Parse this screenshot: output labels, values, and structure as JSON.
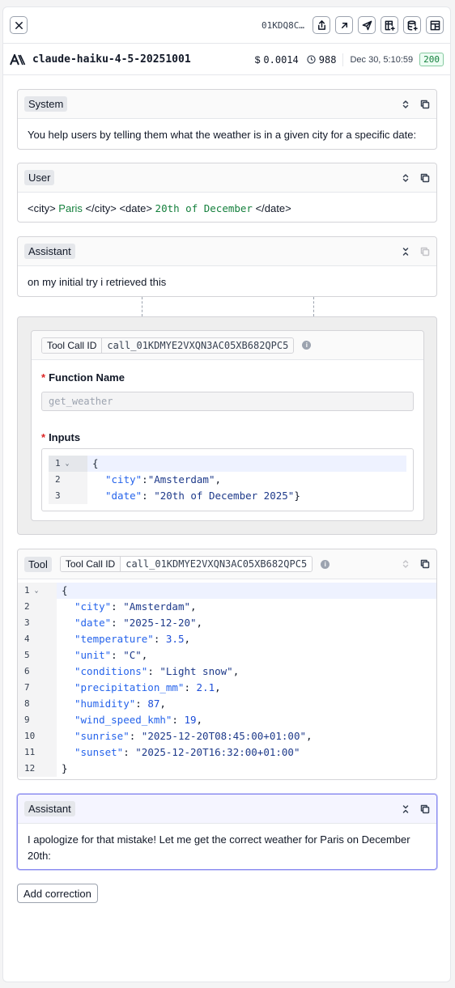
{
  "topbar": {
    "trace_id": "01KDQ8C…"
  },
  "model": {
    "name": "claude-haiku-4-5-20251001",
    "cost": "0.0014",
    "tokens": "988",
    "date": "Dec 30, 5:10:59",
    "status": "200"
  },
  "messages": {
    "system": {
      "role": "System",
      "text": "You help users by telling them what the weather is in a given city for a specific date:"
    },
    "user": {
      "role": "User",
      "parts": [
        "<city> ",
        "Paris",
        " </city> <date> ",
        "20th of December",
        " </date>"
      ]
    },
    "assistant1": {
      "role": "Assistant",
      "text": "on my initial try i retrieved this"
    },
    "tool_call": {
      "id_label": "Tool Call ID",
      "id_value": "call_01KDMYE2VXQN3AC05XB682QPC5",
      "function_label": "Function Name",
      "function_name": "get_weather",
      "inputs_label": "Inputs",
      "inputs_lines": [
        {
          "ln": "1",
          "text": "{"
        },
        {
          "ln": "2",
          "key": "\"city\"",
          "sep": ":",
          "val": "\"Amsterdam\"",
          "end": ","
        },
        {
          "ln": "3",
          "key": "\"date\"",
          "sep": ": ",
          "val": "\"20th of December 2025\"",
          "end": "}"
        }
      ]
    },
    "tool": {
      "role": "Tool",
      "id_label": "Tool Call ID",
      "id_value": "call_01KDMYE2VXQN3AC05XB682QPC5",
      "lines": [
        {
          "ln": "1",
          "text": "{"
        },
        {
          "ln": "2",
          "key": "\"city\"",
          "val": "\"Amsterdam\"",
          "type": "s"
        },
        {
          "ln": "3",
          "key": "\"date\"",
          "val": "\"2025-12-20\"",
          "type": "s"
        },
        {
          "ln": "4",
          "key": "\"temperature\"",
          "val": "3.5",
          "type": "n"
        },
        {
          "ln": "5",
          "key": "\"unit\"",
          "val": "\"C\"",
          "type": "s"
        },
        {
          "ln": "6",
          "key": "\"conditions\"",
          "val": "\"Light snow\"",
          "type": "s"
        },
        {
          "ln": "7",
          "key": "\"precipitation_mm\"",
          "val": "2.1",
          "type": "n"
        },
        {
          "ln": "8",
          "key": "\"humidity\"",
          "val": "87",
          "type": "n"
        },
        {
          "ln": "9",
          "key": "\"wind_speed_kmh\"",
          "val": "19",
          "type": "n"
        },
        {
          "ln": "10",
          "key": "\"sunrise\"",
          "val": "\"2025-12-20T08:45:00+01:00\"",
          "type": "s"
        },
        {
          "ln": "11",
          "key": "\"sunset\"",
          "val": "\"2025-12-20T16:32:00+01:00\"",
          "type": "s",
          "last": true
        },
        {
          "ln": "12",
          "text": "}"
        }
      ]
    },
    "assistant2": {
      "role": "Assistant",
      "text": "I apologize for that mistake! Let me get the correct weather for Paris on December 20th:"
    }
  },
  "actions": {
    "add_correction": "Add correction"
  },
  "colors": {
    "accent": "#6366f1",
    "success": "#15803d",
    "border": "#d4d4d8"
  }
}
